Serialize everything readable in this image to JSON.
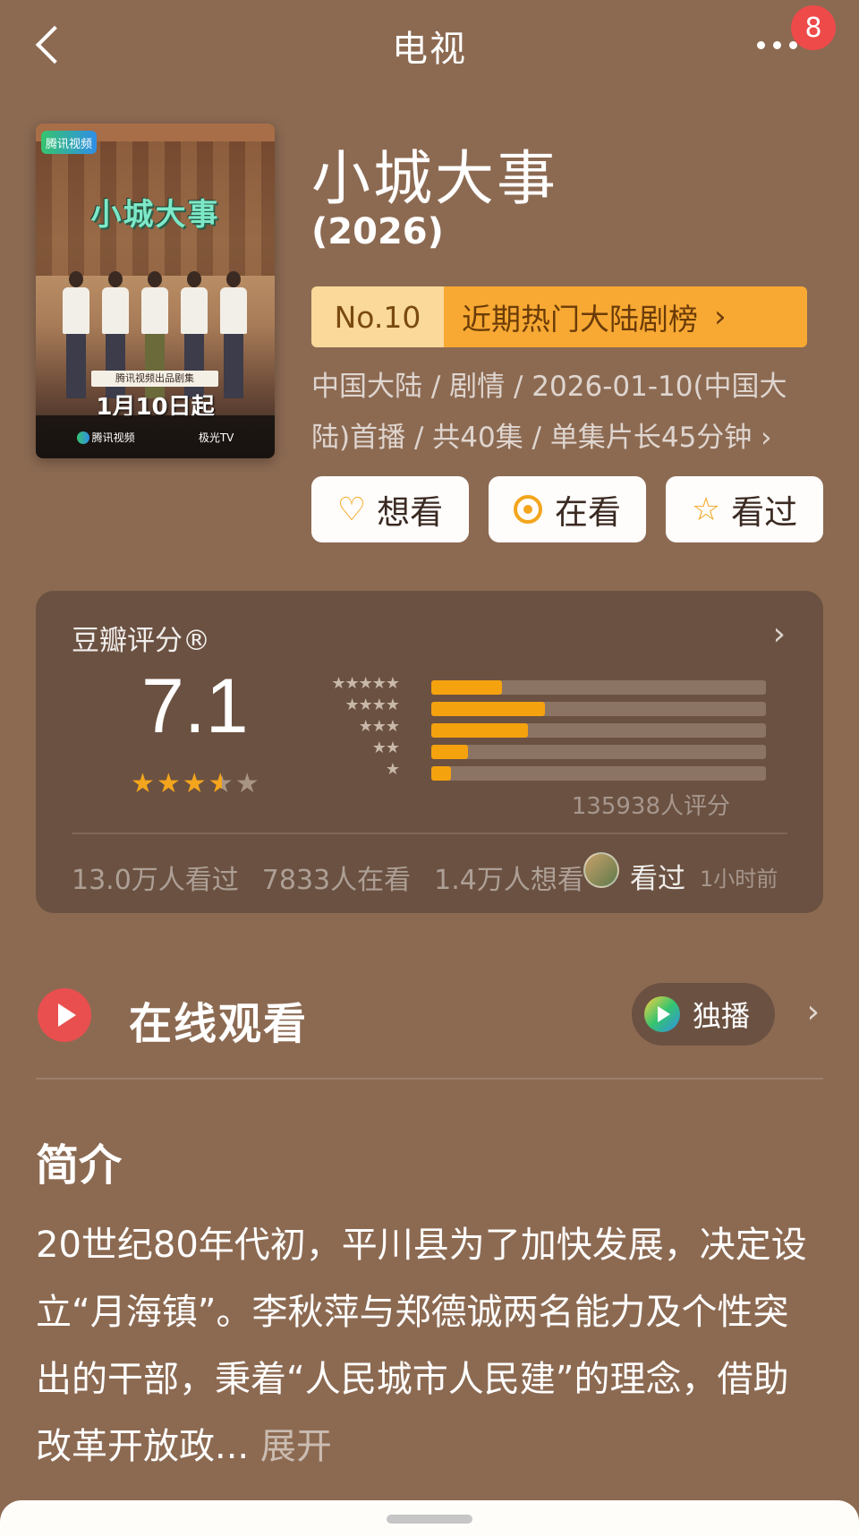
{
  "header": {
    "title": "电视",
    "badge": "8"
  },
  "poster": {
    "brand": "腾讯视频",
    "title": "小城大事",
    "ribbon": "腾讯视频出品剧集",
    "date": "1月10日起",
    "bottom_left": "腾讯视频",
    "bottom_right": "极光TV"
  },
  "drama": {
    "title": "小城大事",
    "year": "(2026)",
    "rank_no": "No.10",
    "rank_name": "近期热门大陆剧榜",
    "meta": "中国大陆 / 剧情 / 2026-01-10(中国大陆)首播 / 共40集 / 单集片长45分钟 ›"
  },
  "actions": {
    "want": "想看",
    "watching": "在看",
    "watched": "看过"
  },
  "rating": {
    "label": "豆瓣评分®",
    "score": "7.1",
    "star_rating": 3.5,
    "distribution": [
      {
        "stars": "★★★★★",
        "fraction": 0.21
      },
      {
        "stars": "★★★★",
        "fraction": 0.34
      },
      {
        "stars": "★★★",
        "fraction": 0.29
      },
      {
        "stars": "★★",
        "fraction": 0.11
      },
      {
        "stars": "★",
        "fraction": 0.06
      }
    ],
    "count": "135938人评分",
    "stats": {
      "watched": "13.0万人看过",
      "watching": "7833人在看",
      "want": "1.4万人想看"
    },
    "friend_action": "看过",
    "friend_time": "1小时前"
  },
  "online": {
    "title": "在线观看",
    "exclusive": "独播"
  },
  "synopsis": {
    "title": "简介",
    "text": "20世纪80年代初，平川县为了加快发展，决定设立“月海镇”。李秋萍与郑德诚两名能力及个性突出的干部，秉着“人民城市人民建”的理念，借助改革开放政...",
    "expand": "展开"
  },
  "colors": {
    "background": "#8c6a52",
    "card": "#6b5141",
    "accent": "#f3a51d",
    "badge": "#ef4a4a",
    "play": "#e94f4f"
  }
}
